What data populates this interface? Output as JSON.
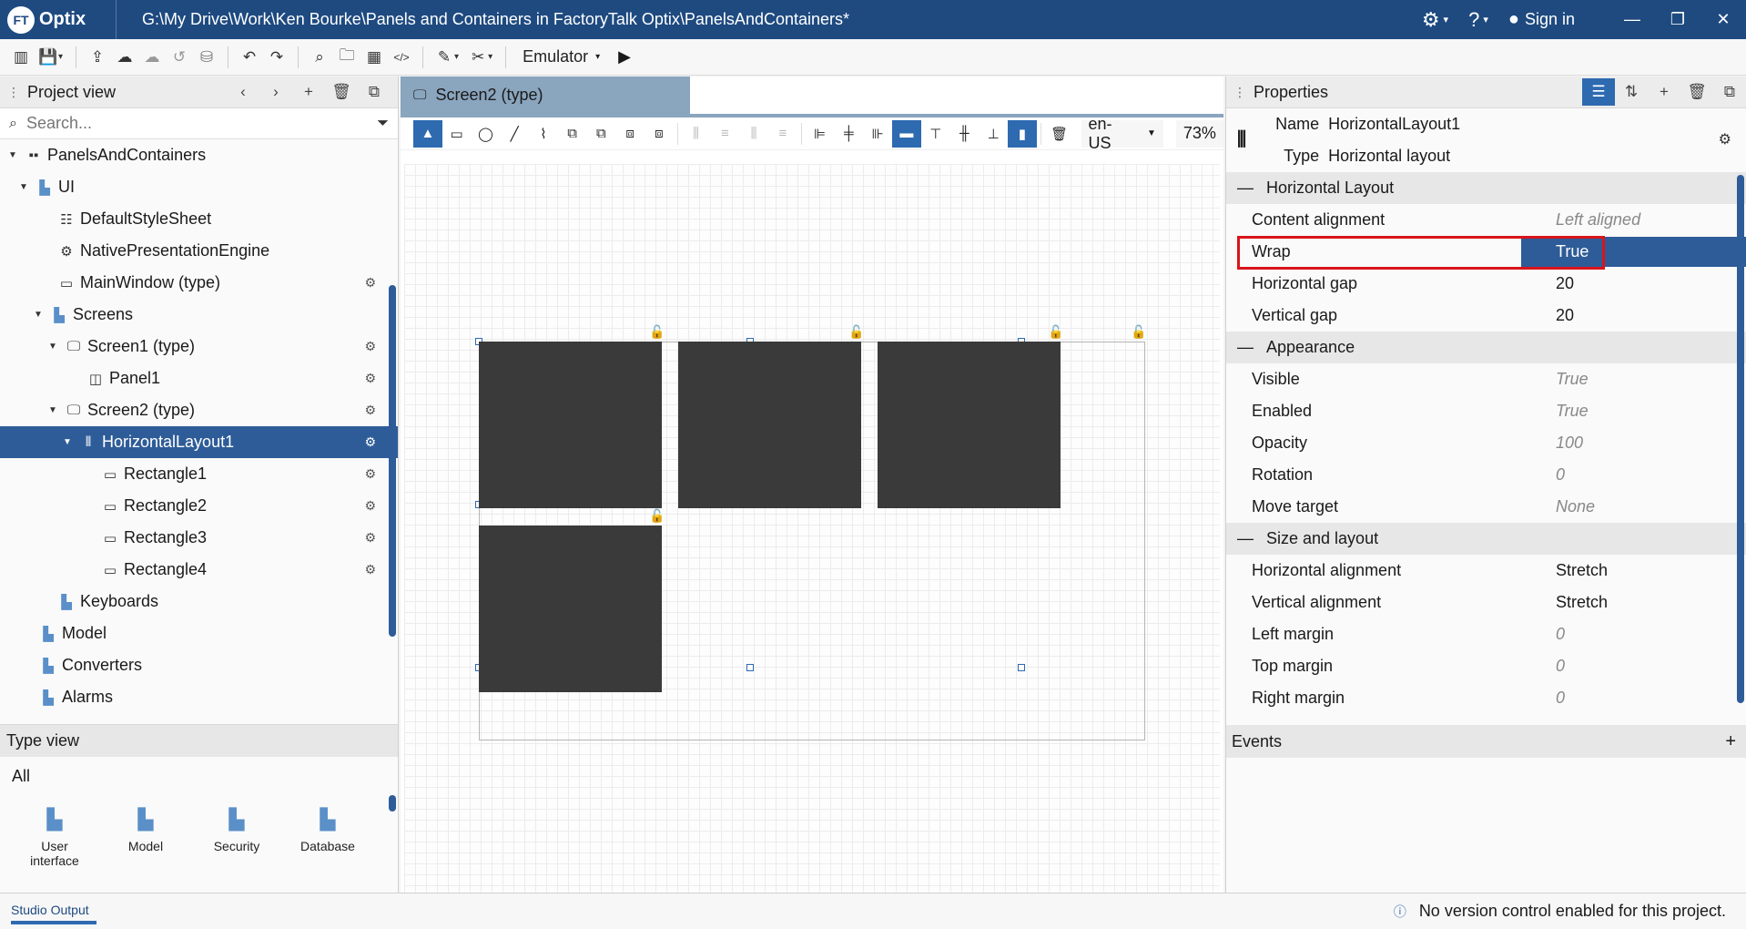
{
  "app": {
    "logo_badge": "FT",
    "logo_text": "Optix",
    "title_path": "G:\\My Drive\\Work\\Ken Bourke\\Panels and Containers in FactoryTalk Optix\\PanelsAndContainers*",
    "sign_in": "Sign in"
  },
  "toolbar": {
    "emulator_label": "Emulator"
  },
  "project_view": {
    "title": "Project view",
    "search_placeholder": "Search...",
    "tree": [
      {
        "label": "PanelsAndContainers"
      },
      {
        "label": "UI"
      },
      {
        "label": "DefaultStyleSheet"
      },
      {
        "label": "NativePresentationEngine"
      },
      {
        "label": "MainWindow (type)"
      },
      {
        "label": "Screens"
      },
      {
        "label": "Screen1 (type)"
      },
      {
        "label": "Panel1"
      },
      {
        "label": "Screen2 (type)"
      },
      {
        "label": "HorizontalLayout1"
      },
      {
        "label": "Rectangle1"
      },
      {
        "label": "Rectangle2"
      },
      {
        "label": "Rectangle3"
      },
      {
        "label": "Rectangle4"
      },
      {
        "label": "Keyboards"
      },
      {
        "label": "Model"
      },
      {
        "label": "Converters"
      },
      {
        "label": "Alarms"
      }
    ]
  },
  "type_view": {
    "title": "Type view",
    "filter": "All",
    "items": [
      {
        "label": "User interface"
      },
      {
        "label": "Model"
      },
      {
        "label": "Security"
      },
      {
        "label": "Database"
      }
    ]
  },
  "editor": {
    "tab_label": "Screen2 (type)",
    "locale": "en-US",
    "zoom": "73%"
  },
  "properties": {
    "title": "Properties",
    "name_key": "Name",
    "name_value": "HorizontalLayout1",
    "type_key": "Type",
    "type_value": "Horizontal layout",
    "sections": {
      "horizontal_layout": "Horizontal Layout",
      "appearance": "Appearance",
      "size_layout": "Size and layout"
    },
    "rows": {
      "content_alignment": {
        "key": "Content alignment",
        "value": "Left aligned"
      },
      "wrap": {
        "key": "Wrap",
        "value": "True"
      },
      "horizontal_gap": {
        "key": "Horizontal gap",
        "value": "20"
      },
      "vertical_gap": {
        "key": "Vertical gap",
        "value": "20"
      },
      "visible": {
        "key": "Visible",
        "value": "True"
      },
      "enabled": {
        "key": "Enabled",
        "value": "True"
      },
      "opacity": {
        "key": "Opacity",
        "value": "100"
      },
      "rotation": {
        "key": "Rotation",
        "value": "0"
      },
      "move_target": {
        "key": "Move target",
        "value": "None"
      },
      "horizontal_alignment": {
        "key": "Horizontal alignment",
        "value": "Stretch"
      },
      "vertical_alignment": {
        "key": "Vertical alignment",
        "value": "Stretch"
      },
      "left_margin": {
        "key": "Left margin",
        "value": "0"
      },
      "top_margin": {
        "key": "Top margin",
        "value": "0"
      },
      "right_margin": {
        "key": "Right margin",
        "value": "0"
      }
    },
    "events_label": "Events"
  },
  "status": {
    "output_tab": "Studio Output",
    "message": "No version control enabled for this project."
  },
  "colors": {
    "titlebar": "#1e4a80",
    "selection": "#2e5c98",
    "highlight_box": "#d9141b",
    "rectangle_fill": "#3a3a3a"
  }
}
